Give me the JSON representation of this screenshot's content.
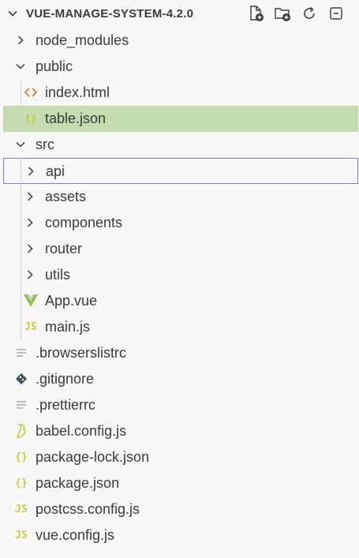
{
  "explorer": {
    "title": "VUE-MANAGE-SYSTEM-4.2.0",
    "actions": [
      {
        "name": "new-file-icon",
        "label": "New File"
      },
      {
        "name": "new-folder-icon",
        "label": "New Folder"
      },
      {
        "name": "refresh-icon",
        "label": "Refresh"
      },
      {
        "name": "collapse-all-icon",
        "label": "Collapse All"
      }
    ]
  },
  "tree": [
    {
      "label": "node_modules",
      "kind": "folder",
      "expanded": false,
      "depth": 0
    },
    {
      "label": "public",
      "kind": "folder",
      "expanded": true,
      "depth": 0
    },
    {
      "label": "index.html",
      "kind": "html",
      "depth": 1
    },
    {
      "label": "table.json",
      "kind": "json",
      "depth": 1,
      "selected": true
    },
    {
      "label": "src",
      "kind": "folder",
      "expanded": true,
      "depth": 0
    },
    {
      "label": "api",
      "kind": "folder",
      "expanded": false,
      "depth": 1,
      "focused": true
    },
    {
      "label": "assets",
      "kind": "folder",
      "expanded": false,
      "depth": 1
    },
    {
      "label": "components",
      "kind": "folder",
      "expanded": false,
      "depth": 1
    },
    {
      "label": "router",
      "kind": "folder",
      "expanded": false,
      "depth": 1
    },
    {
      "label": "utils",
      "kind": "folder",
      "expanded": false,
      "depth": 1
    },
    {
      "label": "App.vue",
      "kind": "vue",
      "depth": 1
    },
    {
      "label": "main.js",
      "kind": "js",
      "depth": 1
    },
    {
      "label": ".browserslistrc",
      "kind": "text",
      "depth": 0
    },
    {
      "label": ".gitignore",
      "kind": "git",
      "depth": 0
    },
    {
      "label": ".prettierrc",
      "kind": "text",
      "depth": 0
    },
    {
      "label": "babel.config.js",
      "kind": "babel",
      "depth": 0
    },
    {
      "label": "package-lock.json",
      "kind": "json",
      "depth": 0
    },
    {
      "label": "package.json",
      "kind": "json",
      "depth": 0
    },
    {
      "label": "postcss.config.js",
      "kind": "js",
      "depth": 0
    },
    {
      "label": "vue.config.js",
      "kind": "js",
      "depth": 0
    }
  ],
  "icon_colors": {
    "html": "#e37933",
    "json": "#cbcb41",
    "js": "#cbcb41",
    "vue": "#8dc149",
    "babel": "#cbcb41",
    "git": "#41535b",
    "text": "#a8a8a8",
    "chevron": "#3b3b3b"
  }
}
